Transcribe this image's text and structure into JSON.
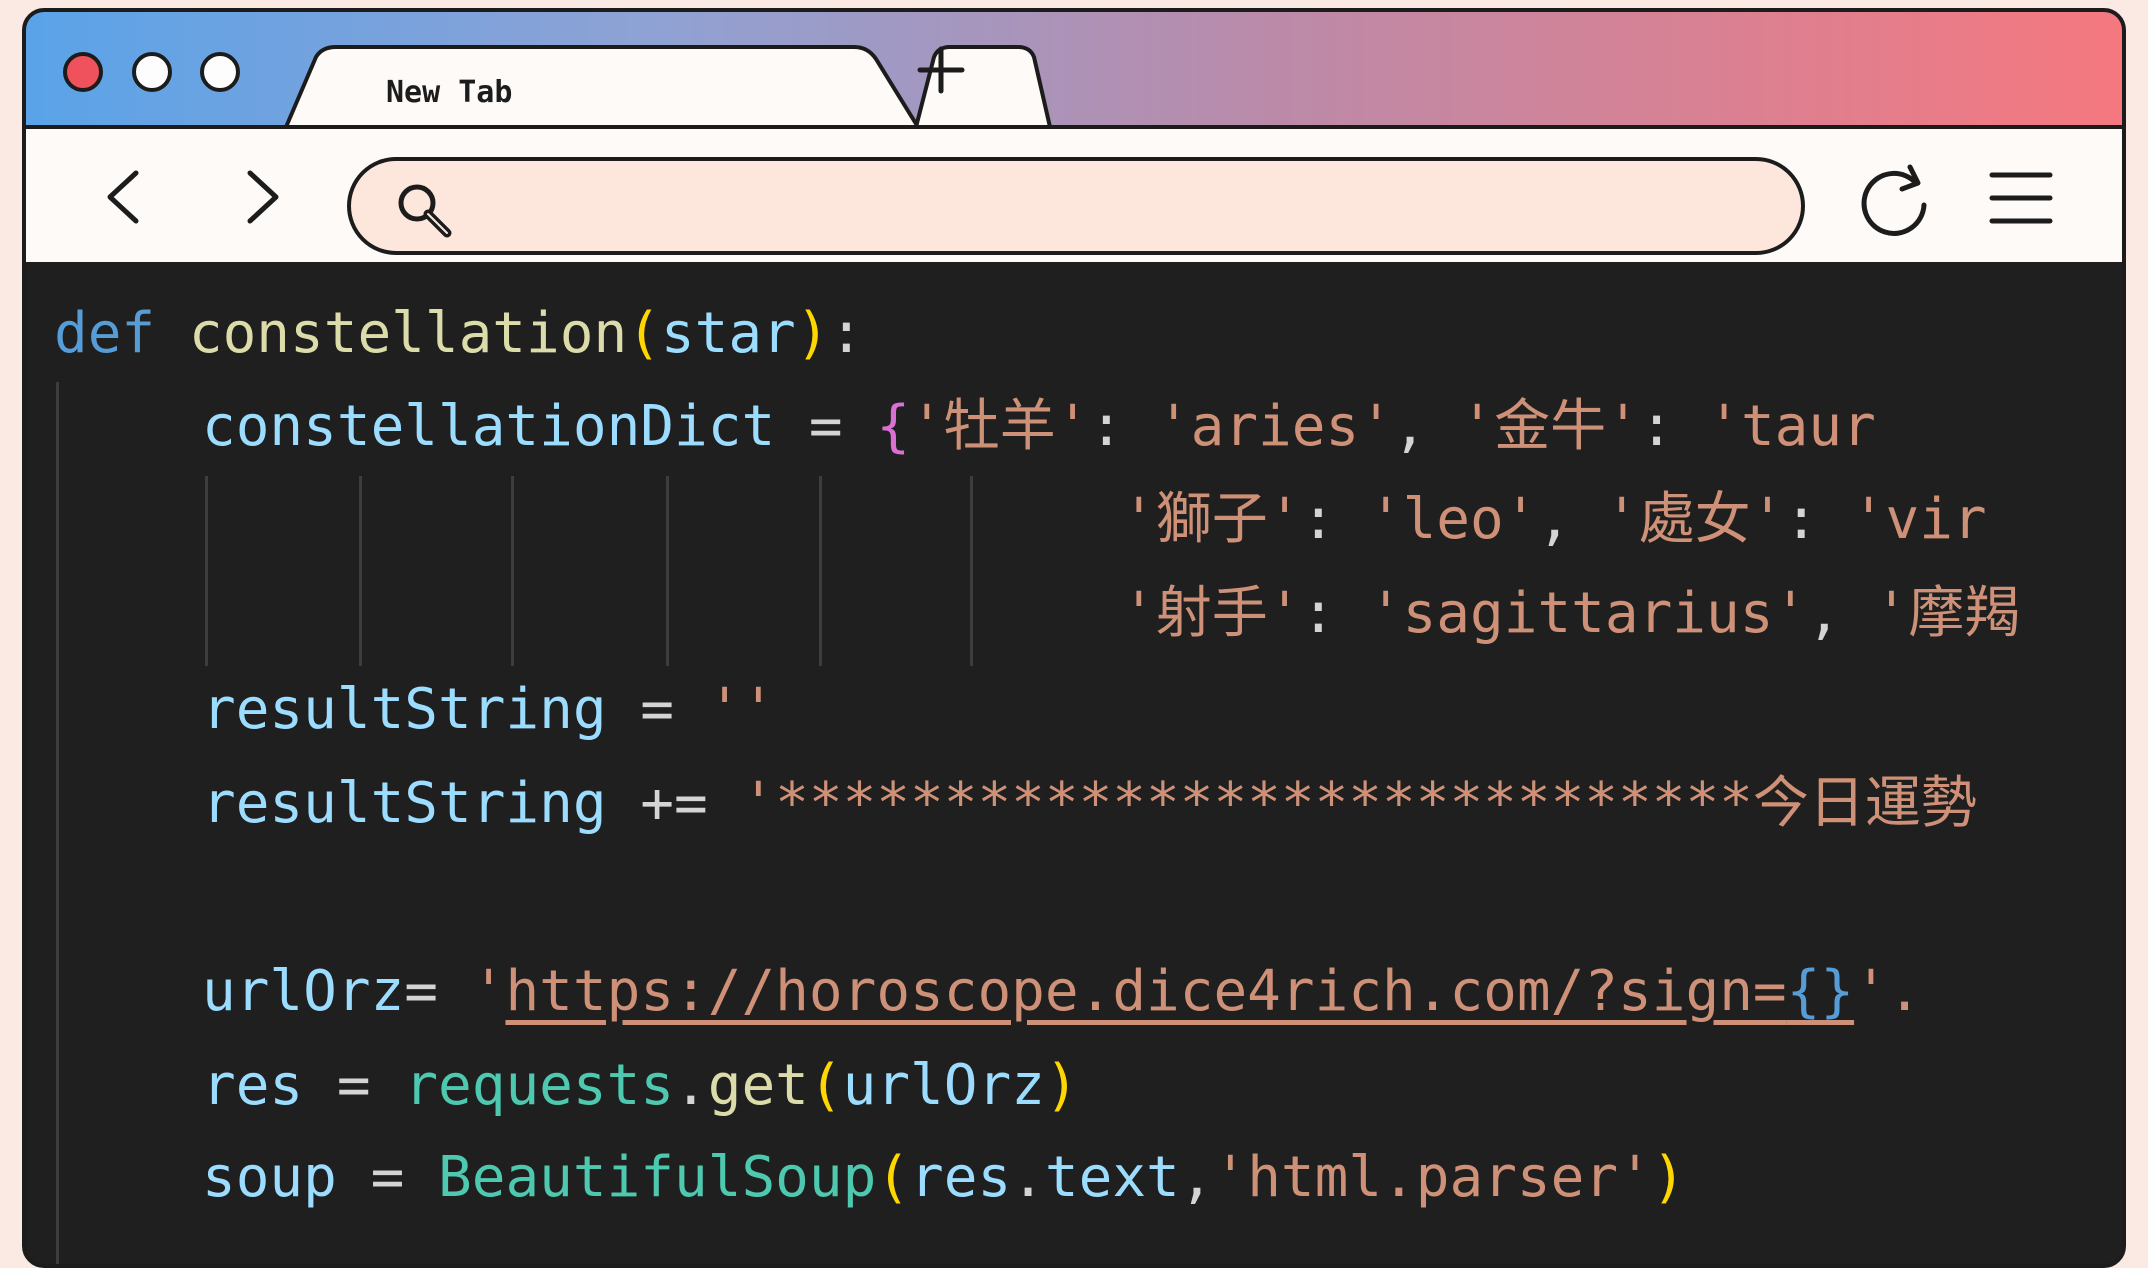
{
  "tab": {
    "title": "New Tab"
  },
  "address_bar": {
    "value": ""
  },
  "code": {
    "l1": {
      "kw": "def",
      "name": "constellation",
      "p1": "(",
      "param": "star",
      "p2": ")",
      "colon": ":"
    },
    "l2": {
      "var": "constellationDict",
      "eq": " = ",
      "brace": "{",
      "s1": "'牡羊'",
      "c1": ": ",
      "s2": "'aries'",
      "c2": ", ",
      "s3": "'金牛'",
      "c3": ": ",
      "s4": "'taur"
    },
    "l3": {
      "s1": "'獅子'",
      "c1": ": ",
      "s2": "'leo'",
      "c2": ", ",
      "s3": "'處女'",
      "c3": ": ",
      "s4": "'vir"
    },
    "l4": {
      "s1": "'射手'",
      "c1": ": ",
      "s2": "'sagittarius'",
      "c2": ", ",
      "s3": "'摩羯"
    },
    "l5": {
      "var": "resultString",
      "op": " = ",
      "str": "''"
    },
    "l6": {
      "var": "resultString",
      "op": " += ",
      "str": "'*****************************今日運勢"
    },
    "l8": {
      "var": "urlOrz",
      "op": "= ",
      "q1": "'",
      "url": "https://horoscope.dice4rich.com/?sign=",
      "fmt": "{}",
      "q2": "'."
    },
    "l9": {
      "var": "res",
      "op": " = ",
      "mod": "requests",
      "dot": ".",
      "fn": "get",
      "p1": "(",
      "arg": "urlOrz",
      "p2": ")"
    },
    "l10": {
      "var": "soup",
      "op": " = ",
      "cls": "BeautifulSoup",
      "p1": "(",
      "a1": "res",
      "dot": ".",
      "a2": "text",
      "comma": ",",
      "str": "'html.parser'",
      "p2": ")"
    }
  }
}
